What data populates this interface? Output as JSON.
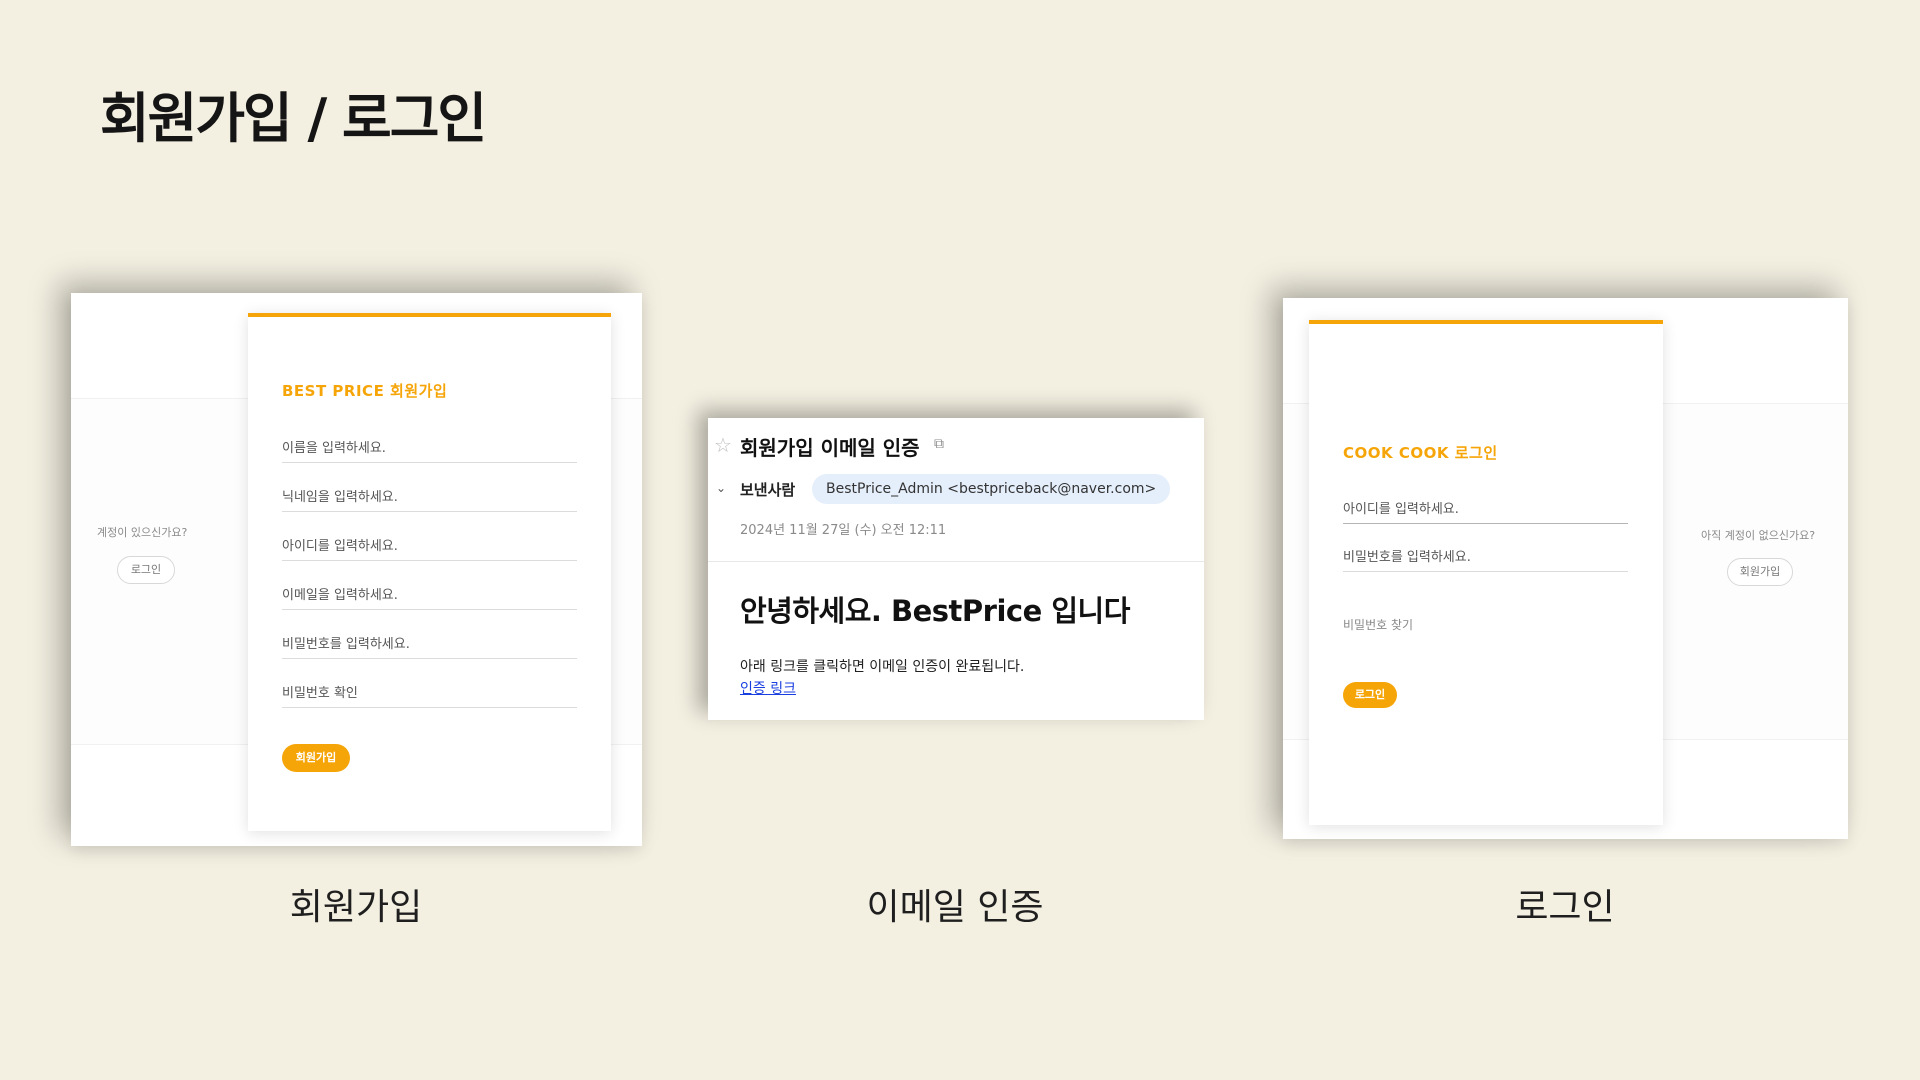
{
  "page": {
    "title": "회원가입 / 로그인",
    "captions": [
      "회원가입",
      "이메일 인증",
      "로그인"
    ]
  },
  "signup": {
    "side_question": "계정이 있으신가요?",
    "side_button": "로그인",
    "title": "BEST PRICE 회원가입",
    "fields": [
      "이름을 입력하세요.",
      "닉네임을 입력하세요.",
      "아이디를 입력하세요.",
      "이메일을 입력하세요.",
      "비밀번호를 입력하세요.",
      "비밀번호 확인"
    ],
    "submit": "회원가입",
    "accent": "#f6a509"
  },
  "email": {
    "subject": "회원가입 이메일 인증",
    "sender_label": "보낸사람",
    "sender": "BestPrice_Admin <bestpriceback@naver.com>",
    "date": "2024년 11월 27일 (수) 오전 12:11",
    "heading": "안녕하세요. BestPrice 입니다",
    "body": "아래 링크를 클릭하면 이메일 인증이 완료됩니다.",
    "link": "인증 링크",
    "icons": [
      "star-icon",
      "external-link-icon",
      "chevron-down-icon"
    ]
  },
  "login": {
    "title": "COOK COOK 로그인",
    "fields": [
      "아이디를 입력하세요.",
      "비밀번호를 입력하세요."
    ],
    "find_password": "비밀번호 찾기",
    "submit": "로그인",
    "side_question": "아직 계정이 없으신가요?",
    "side_button": "회원가입",
    "accent": "#f6a509"
  }
}
